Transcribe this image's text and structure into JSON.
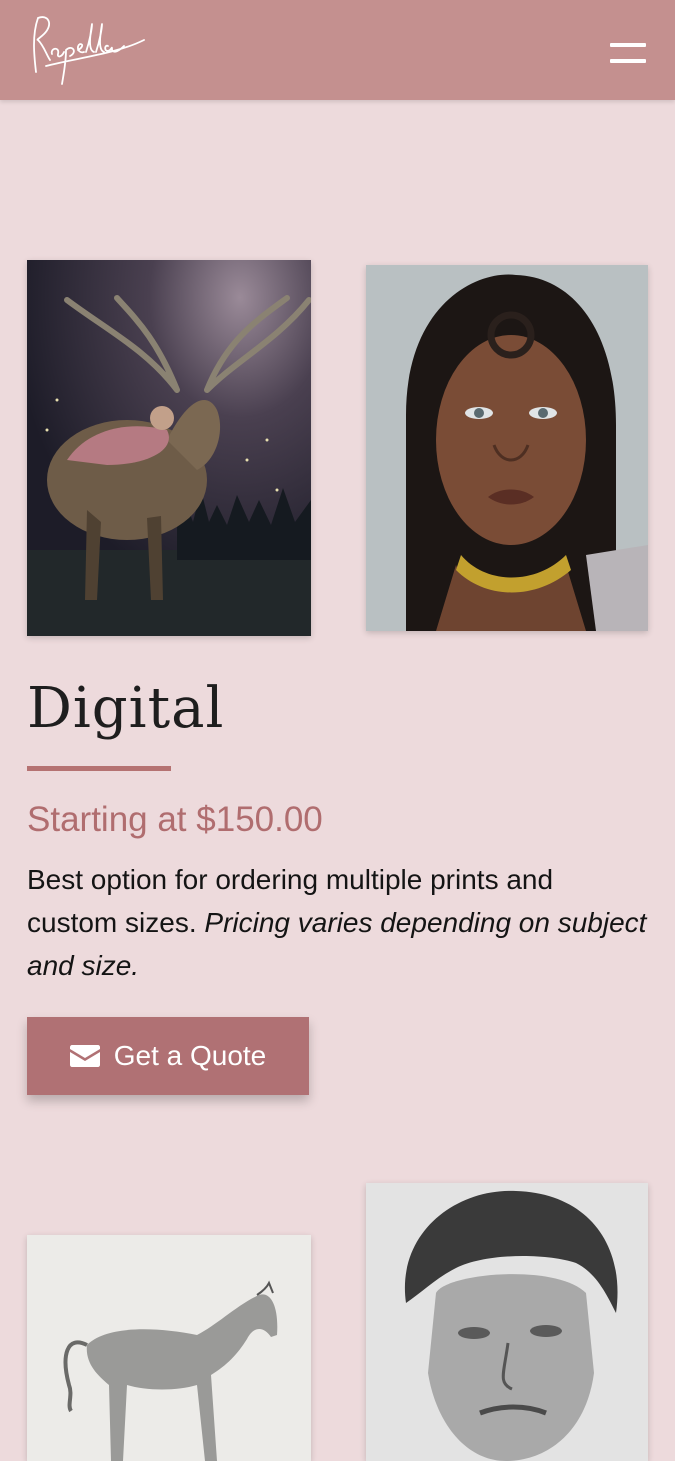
{
  "header": {
    "logo_text": "Rapella",
    "menu_icon": "hamburger-menu-icon",
    "background_color": "#c4908f"
  },
  "gallery_top": [
    {
      "subject": "stag-with-girl-digital-painting"
    },
    {
      "subject": "woman-portrait-digital-painting"
    }
  ],
  "section": {
    "title": "Digital",
    "price": "Starting at $150.00",
    "description_plain": "Best option for ordering multiple prints and custom sizes. ",
    "description_italic": "Pricing varies depending on subject and size.",
    "cta_label": "Get a Quote",
    "cta_icon": "envelope-icon",
    "accent_color": "#b07174"
  },
  "gallery_bottom": [
    {
      "subject": "horse-pencil-drawing"
    },
    {
      "subject": "man-portrait-pencil-drawing"
    }
  ]
}
